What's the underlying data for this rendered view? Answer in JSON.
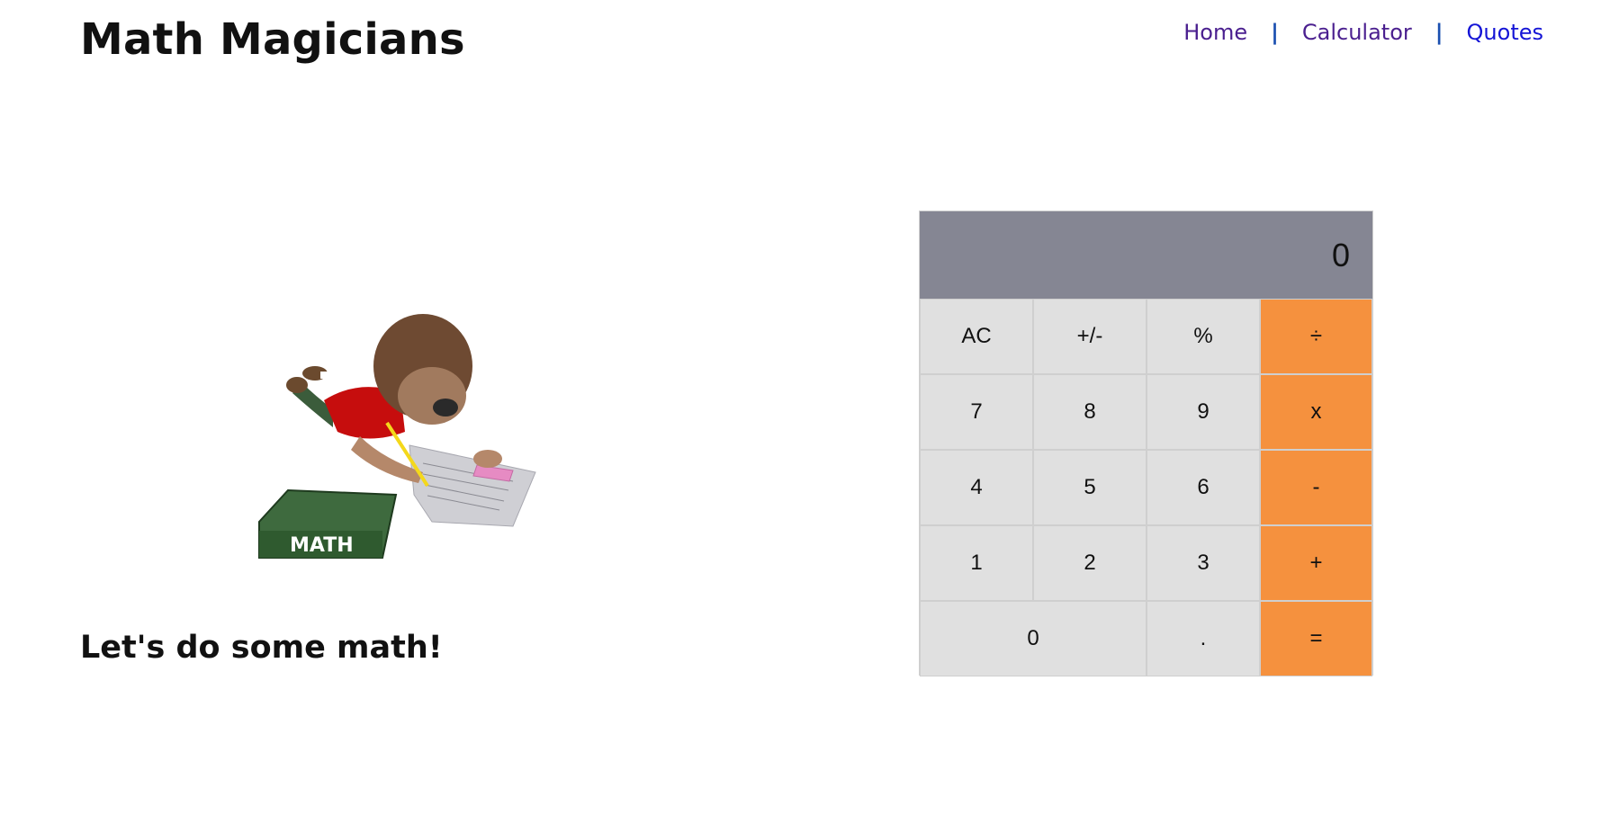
{
  "header": {
    "title": "Math Magicians",
    "nav": [
      {
        "label": "Home"
      },
      {
        "label": "Calculator"
      },
      {
        "label": "Quotes"
      }
    ],
    "separator": "|"
  },
  "hero": {
    "tagline": "Let's do some math!",
    "book_label": "MATH"
  },
  "calculator": {
    "display": "0",
    "keys": {
      "ac": "AC",
      "plus_minus": "+/-",
      "percent": "%",
      "divide": "÷",
      "seven": "7",
      "eight": "8",
      "nine": "9",
      "multiply": "x",
      "four": "4",
      "five": "5",
      "six": "6",
      "minus": "-",
      "one": "1",
      "two": "2",
      "three": "3",
      "plus": "+",
      "zero": "0",
      "decimal": ".",
      "equals": "="
    }
  },
  "colors": {
    "display_bg": "#858693",
    "key_bg": "#e0e0e0",
    "operator_bg": "#f5913e",
    "nav_visited": "#4a1f8f",
    "nav_link": "#1414d6"
  }
}
